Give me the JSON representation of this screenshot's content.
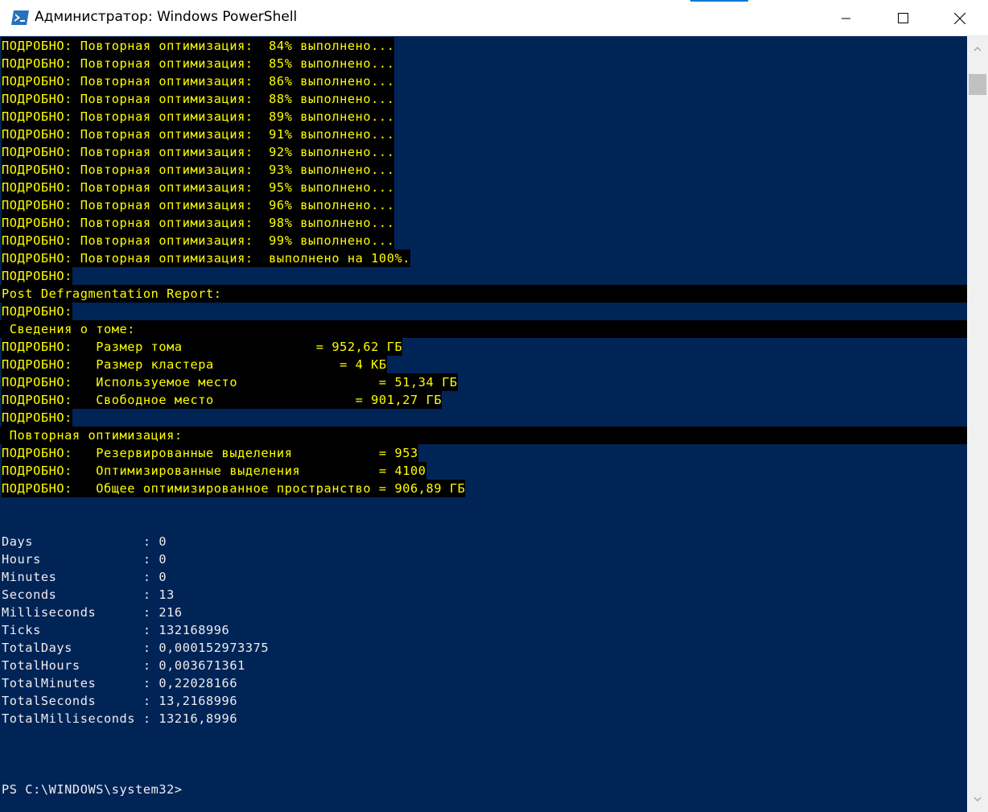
{
  "window": {
    "title": "Администратор: Windows PowerShell",
    "app_icon": "powershell-icon",
    "controls": {
      "minimize": "minimize-icon",
      "maximize": "maximize-icon",
      "close": "close-icon"
    }
  },
  "colors": {
    "console_bg": "#012456",
    "verbose_fg": "#ffff00",
    "verbose_bg": "#000000",
    "normal_fg": "#eeedf0",
    "accent": "#0078d7"
  },
  "progress_lines": [
    "ПОДРОБНО: Повторная оптимизация:  84% выполнено...",
    "ПОДРОБНО: Повторная оптимизация:  85% выполнено...",
    "ПОДРОБНО: Повторная оптимизация:  86% выполнено...",
    "ПОДРОБНО: Повторная оптимизация:  88% выполнено...",
    "ПОДРОБНО: Повторная оптимизация:  89% выполнено...",
    "ПОДРОБНО: Повторная оптимизация:  91% выполнено...",
    "ПОДРОБНО: Повторная оптимизация:  92% выполнено...",
    "ПОДРОБНО: Повторная оптимизация:  93% выполнено...",
    "ПОДРОБНО: Повторная оптимизация:  95% выполнено...",
    "ПОДРОБНО: Повторная оптимизация:  96% выполнено...",
    "ПОДРОБНО: Повторная оптимизация:  98% выполнено...",
    "ПОДРОБНО: Повторная оптимизация:  99% выполнено...",
    "ПОДРОБНО: Повторная оптимизация:  выполнено на 100%."
  ],
  "report": {
    "verbose_empty": "ПОДРОБНО:",
    "heading": "Post Defragmentation Report:",
    "volume_heading": " Сведения о томе:",
    "volume_lines": [
      "ПОДРОБНО:   Размер тома                 = 952,62 ГБ",
      "ПОДРОБНО:   Размер кластера                = 4 КБ",
      "ПОДРОБНО:   Используемое место                  = 51,34 ГБ",
      "ПОДРОБНО:   Свободное место                  = 901,27 ГБ"
    ],
    "reopt_heading": " Повторная оптимизация:",
    "reopt_lines": [
      "ПОДРОБНО:   Резервированные выделения           = 953",
      "ПОДРОБНО:   Оптимизированные выделения          = 4100",
      "ПОДРОБНО:   Общее оптимизированное пространство = 906,89 ГБ"
    ]
  },
  "timespan": [
    "Days              : 0",
    "Hours             : 0",
    "Minutes           : 0",
    "Seconds           : 13",
    "Milliseconds      : 216",
    "Ticks             : 132168996",
    "TotalDays         : 0,000152973375",
    "TotalHours        : 0,003671361",
    "TotalMinutes      : 0,22028166",
    "TotalSeconds      : 13,2168996",
    "TotalMilliseconds : 13216,8996"
  ],
  "prompt": "PS C:\\WINDOWS\\system32>"
}
